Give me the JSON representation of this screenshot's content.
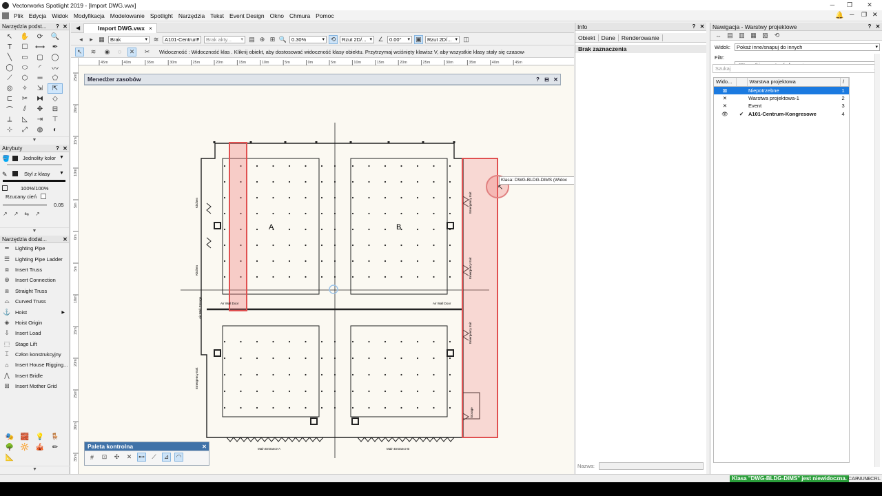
{
  "window": {
    "title": "Vectorworks Spotlight 2019 - [Import DWG.vwx]",
    "controls": [
      "─",
      "❐",
      "✕"
    ]
  },
  "menu": [
    "Plik",
    "Edycja",
    "Widok",
    "Modyfikacja",
    "Modelowanie",
    "Spotlight",
    "Narzędzia",
    "Tekst",
    "Event Design",
    "Okno",
    "Chmura",
    "Pomoc"
  ],
  "tools_palette": {
    "title": "Narzędzia podst...",
    "tools": [
      "arrow-icon",
      "hand-icon",
      "rotate-view-icon",
      "zoom-icon",
      "text-icon",
      "callout-icon",
      "dimension-icon",
      "eyedropper-icon",
      "line-icon",
      "rectangle-icon",
      "rounded-rect-icon",
      "circle-icon",
      "circle-icon",
      "ellipse-icon",
      "arc-icon",
      "freehand-icon",
      "polyline-icon",
      "polygon-icon",
      "double-line-icon",
      "regular-polygon-icon",
      "spiral-icon",
      "wand-icon",
      "offset-icon",
      "selection-tool-icon",
      "clip-icon",
      "trim-icon",
      "mirror-icon",
      "reshape-icon",
      "fillet-icon",
      "split-icon",
      "move-icon",
      "align-icon",
      "connect-icon",
      "chamfer-icon",
      "extend-icon",
      "section-icon",
      "pan-icon",
      "scale-icon",
      "attributes-icon",
      "visibility-icon"
    ]
  },
  "attributes": {
    "title": "Atrybuty",
    "fill": "Jednolity kolor",
    "pen": "Styl z klasy",
    "opacity": "100%/100%",
    "shadow_label": "Rzucany cień",
    "line_weight": "0.05"
  },
  "extra_tools": {
    "title": "Narzędzia dodat...",
    "items": [
      {
        "label": "Lighting Pipe",
        "icon": "pipe-icon"
      },
      {
        "label": "Lighting Pipe Ladder",
        "icon": "ladder-icon"
      },
      {
        "label": "Insert Truss",
        "icon": "truss-icon"
      },
      {
        "label": "Insert Connection",
        "icon": "connection-icon"
      },
      {
        "label": "Straight Truss",
        "icon": "straight-truss-icon"
      },
      {
        "label": "Curved Truss",
        "icon": "curved-truss-icon"
      },
      {
        "label": "Hoist",
        "icon": "hoist-icon",
        "submenu": true
      },
      {
        "label": "Hoist Origin",
        "icon": "hoist-origin-icon"
      },
      {
        "label": "Insert Load",
        "icon": "load-icon"
      },
      {
        "label": "Stage Lift",
        "icon": "stage-lift-icon"
      },
      {
        "label": "Człon konstrukcyjny",
        "icon": "structural-member-icon"
      },
      {
        "label": "Insert House Rigging...",
        "icon": "house-rigging-icon"
      },
      {
        "label": "Insert Bridle",
        "icon": "bridle-icon"
      },
      {
        "label": "Insert Mother Grid",
        "icon": "mother-grid-icon"
      }
    ]
  },
  "document_tab": {
    "label": "Import DWG.vwx",
    "close": "×"
  },
  "view_bar": {
    "class_dropdown": "Brak",
    "layer_dropdown": "A101-Centrum",
    "active_class": "Brak akty...",
    "zoom": "0.30%",
    "view": "Rzut 2D/...",
    "angle": "0.00°",
    "render": "Rzut 2D/..."
  },
  "mode_bar": {
    "help_text": "Widoczność : Widoczność klas . Kliknij obiekt, aby dostosować widoczność klasy obiektu. Przytrzymaj wciśnięty klawisz V, aby wszystkie klasy stały się czasowo wido"
  },
  "ruler": {
    "top_marks": [
      "45m",
      "40m",
      "35m",
      "30m",
      "25m",
      "20m",
      "15m",
      "10m",
      "5m",
      "0m",
      "5m",
      "10m",
      "15m",
      "20m",
      "25m",
      "30m",
      "35m",
      "40m",
      "45m"
    ],
    "left_marks": [
      "25m",
      "20m",
      "15m",
      "10m",
      "5m",
      "0m",
      "5m",
      "10m",
      "15m",
      "20m",
      "25m",
      "30m",
      "35m"
    ]
  },
  "resource_manager": {
    "title": "Menedżer zasobów",
    "buttons": [
      "?",
      "⊟",
      "✕"
    ]
  },
  "drawing": {
    "label_a": "A",
    "label_b": "B",
    "entrance_a": "Main Entrance A",
    "entrance_b": "Main Entrance B",
    "air_wall_door": "Air Wall Door",
    "tooltip": "Klasa: DWG-BLDG-DIMS (Widoc",
    "side_labels": [
      "Kitchen",
      "Kitchen",
      "Air Wall Storage",
      "Emergency Exit",
      "Emergency Exit",
      "Emergency Exit",
      "Emergency Exit",
      "Storage"
    ]
  },
  "control_palette": {
    "title": "Paleta kontrolna",
    "close": "✕"
  },
  "info_panel": {
    "title": "Info",
    "tabs": [
      "Obiekt",
      "Dane",
      "Renderowanie"
    ],
    "selection": "Brak zaznaczenia",
    "name_label": "Nazwa:"
  },
  "navigation": {
    "title": "Nawigacja - Warstwy projektowe",
    "view_label": "Widok:",
    "view_value": "Pokaż inne/snapuj do innych",
    "filter_label": "Filtr:",
    "filter_value": "<Wszystkie warstwy/arkusze>",
    "search_placeholder": "Szukaj",
    "columns": [
      "Wido...",
      "Warstwa projektowa",
      "/"
    ],
    "layers": [
      {
        "visibility": "⊠",
        "active": "",
        "name": "Niepotrzebne",
        "order": "1",
        "selected": true,
        "bold": false
      },
      {
        "visibility": "✕",
        "active": "",
        "name": "Warstwa projektowa-1",
        "order": "2",
        "selected": false,
        "bold": false
      },
      {
        "visibility": "✕",
        "active": "",
        "name": "Event",
        "order": "3",
        "selected": false,
        "bold": false
      },
      {
        "visibility": "👁",
        "active": "✔",
        "name": "A101-Centrum-Kongresowe",
        "order": "4",
        "selected": false,
        "bold": true
      }
    ]
  },
  "status": {
    "message": "Klasa \"DWG-BLDG-DIMS\" jest niewidoczna.",
    "indicators": [
      "CAP",
      "NUM",
      "SCRL"
    ]
  }
}
